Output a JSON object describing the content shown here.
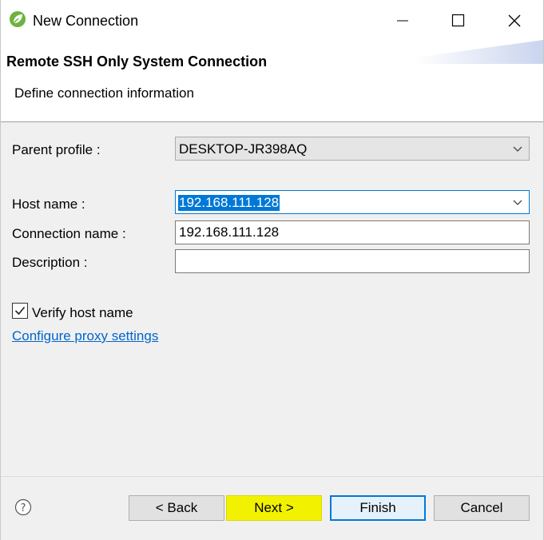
{
  "window": {
    "title": "New Connection"
  },
  "header": {
    "title": "Remote SSH Only System Connection",
    "description": "Define connection information"
  },
  "form": {
    "parent_profile_label": "Parent profile :",
    "parent_profile_value": "DESKTOP-JR398AQ",
    "host_name_label": "Host name :",
    "host_name_value": "192.168.111.128",
    "connection_name_label": "Connection name :",
    "connection_name_value": "192.168.111.128",
    "description_label": "Description :",
    "description_value": "",
    "verify_host_label": "Verify host name",
    "verify_host_checked": true,
    "proxy_link": "Configure proxy settings"
  },
  "buttons": {
    "back": "< Back",
    "next": "Next >",
    "finish": "Finish",
    "cancel": "Cancel"
  },
  "icons": {
    "app": "spring-leaf-icon",
    "help": "help-icon"
  },
  "colors": {
    "accent": "#0078d7",
    "link": "#0066cc",
    "highlight": "#f2f200"
  }
}
